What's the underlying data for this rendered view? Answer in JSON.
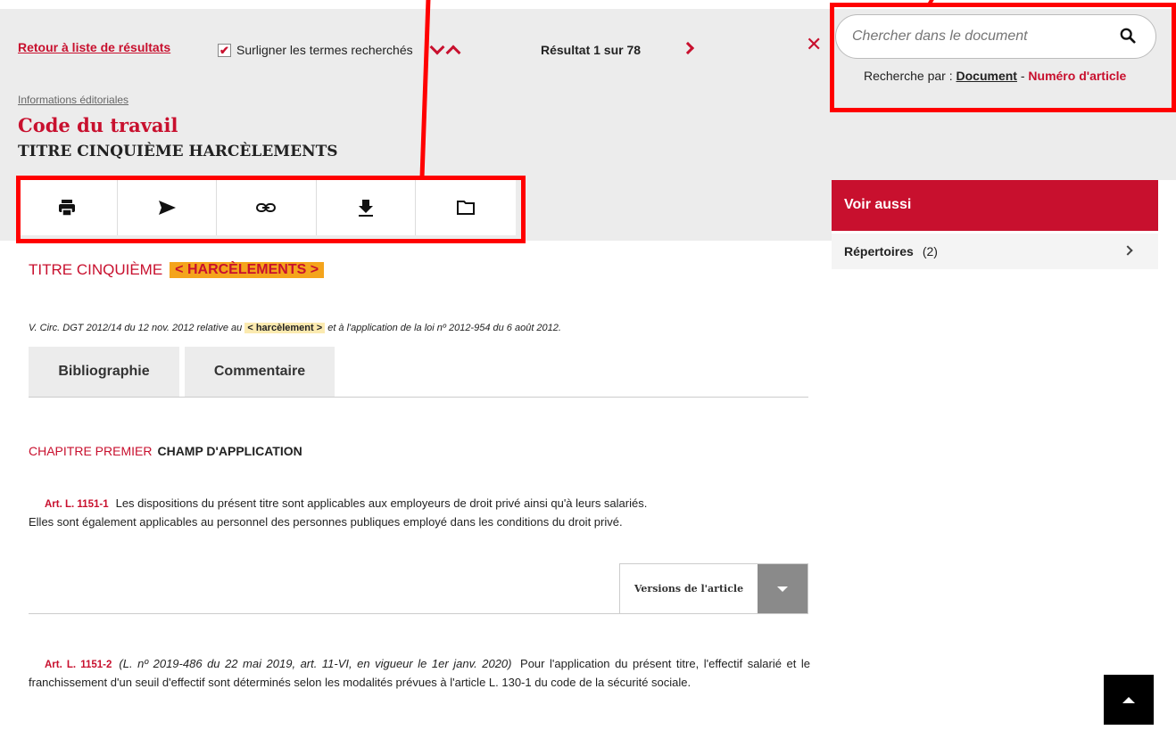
{
  "header": {
    "back_link": "Retour à liste de résultats",
    "highlight_label": "Surligner les termes recherchés",
    "result_counter": "Résultat 1 sur 78",
    "close_symbol": "✕"
  },
  "search": {
    "placeholder": "Chercher dans le document",
    "search_by_prefix": "Recherche par :",
    "by_document": "Document",
    "separator": "-",
    "by_article_number": "Numéro d'article"
  },
  "document": {
    "editorial_link": "Informations éditoriales",
    "title": "Code du travail",
    "subtitle": "TITRE CINQUIÈME HARCÈLEMENTS"
  },
  "toolbar": {
    "icons": [
      "print-icon",
      "send-icon",
      "link-icon",
      "download-icon",
      "folder-icon"
    ]
  },
  "sidebar": {
    "see_also_title": "Voir aussi",
    "repertoires_label": "Répertoires",
    "repertoires_count": "(2)"
  },
  "content": {
    "titre_label": "TITRE CINQUIÈME",
    "titre_highlight": "< HARCÈLEMENTS >",
    "circ_note_prefix": "V. Circ. DGT 2012/14 du 12 nov. 2012 relative au",
    "circ_note_highlight": "< harcèlement >",
    "circ_note_suffix": "et à l'application de la loi nº 2012-954 du 6 août 2012.",
    "tabs": [
      "Bibliographie",
      "Commentaire"
    ],
    "chapter_label": "CHAPITRE PREMIER",
    "chapter_title": "CHAMP D'APPLICATION",
    "art1_ref": "Art. L. 1151-1",
    "art1_text_1": "Les dispositions du présent titre sont applicables aux employeurs de droit privé ainsi qu'à leurs salariés.",
    "art1_text_2": "Elles sont également applicables au personnel des personnes publiques employé dans les conditions du droit privé.",
    "versions_label": "Versions de l'article",
    "art2_ref": "Art. L. 1151-2",
    "art2_note": "(L. nº 2019-486 du 22 mai 2019, art. 11-VI, en vigueur le 1er janv. 2020)",
    "art2_text": "Pour l'application du présent titre, l'effectif salarié et le franchissement d'un seuil d'effectif sont déterminés selon les modalités prévues à l'article L. 130-1 du code de la sécurité sociale."
  },
  "colors": {
    "brand_red": "#c8102e",
    "highlight_orange": "#f4a41c",
    "annotation_red": "#ff0000"
  }
}
